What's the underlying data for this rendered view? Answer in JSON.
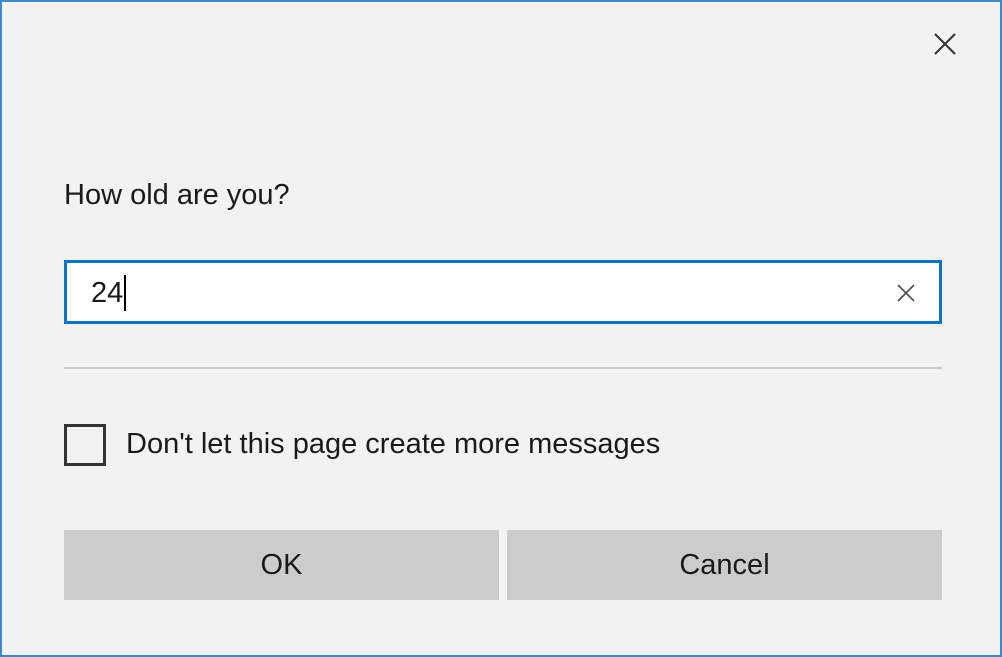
{
  "dialog": {
    "prompt": "How old are you?",
    "input": {
      "value": "24"
    },
    "checkbox": {
      "label": "Don't let this page create more messages",
      "checked": false
    },
    "buttons": {
      "ok_label": "OK",
      "cancel_label": "Cancel"
    },
    "icons": {
      "close": "close-icon",
      "clear": "clear-input-icon"
    }
  },
  "colors": {
    "background": "#f2f2f2",
    "window_border": "#3a8ad0",
    "input_focus_border": "#0a74cd",
    "button_bg": "#cccccc",
    "divider": "#c9c9c9"
  }
}
